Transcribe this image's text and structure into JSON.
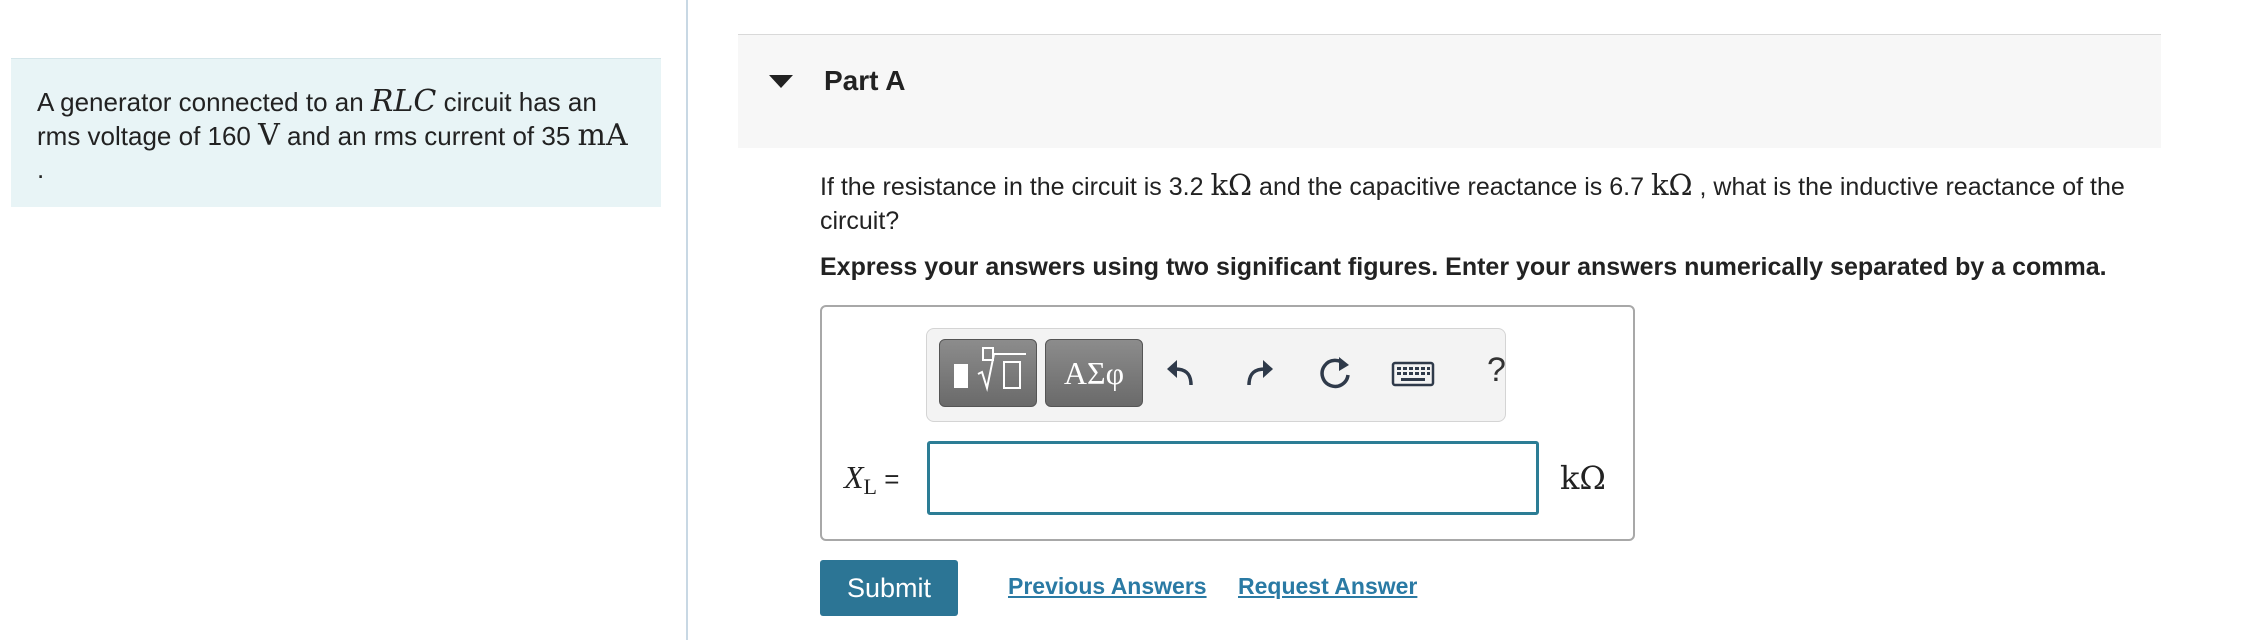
{
  "intro": {
    "text_1": "A generator connected to an ",
    "circuit": "RLC",
    "text_2": " circuit has an rms voltage of 160 ",
    "voltage_unit": "V",
    "text_3": " and an rms current of 35 ",
    "current_unit": "mA",
    "text_4": "."
  },
  "part": {
    "title": "Part A"
  },
  "question": {
    "text_1": "If the resistance in the circuit is 3.2 ",
    "r_unit": "kΩ",
    "text_2": " and the capacitive reactance is 6.7 ",
    "c_unit": "kΩ",
    "text_3": " , what is the inductive reactance of the circuit?"
  },
  "instruction": "Express your answers using two significant figures. Enter your answers numerically separated by a comma.",
  "toolbar": {
    "symbols_label": "ΑΣφ",
    "help_label": "?",
    "icons": [
      "templates-icon",
      "symbols-icon",
      "undo-icon",
      "redo-icon",
      "reset-icon",
      "keyboard-icon",
      "help-icon"
    ]
  },
  "answer": {
    "label_main": "X",
    "label_sub": "L",
    "label_eq": " =",
    "value": "",
    "unit": "kΩ"
  },
  "actions": {
    "submit": "Submit",
    "previous_answers": "Previous Answers",
    "request_answer": "Request Answer"
  },
  "colors": {
    "intro_bg": "#e8f4f6",
    "accent": "#2c7595",
    "link": "#2a7aa4",
    "input_border": "#2c7d95"
  }
}
